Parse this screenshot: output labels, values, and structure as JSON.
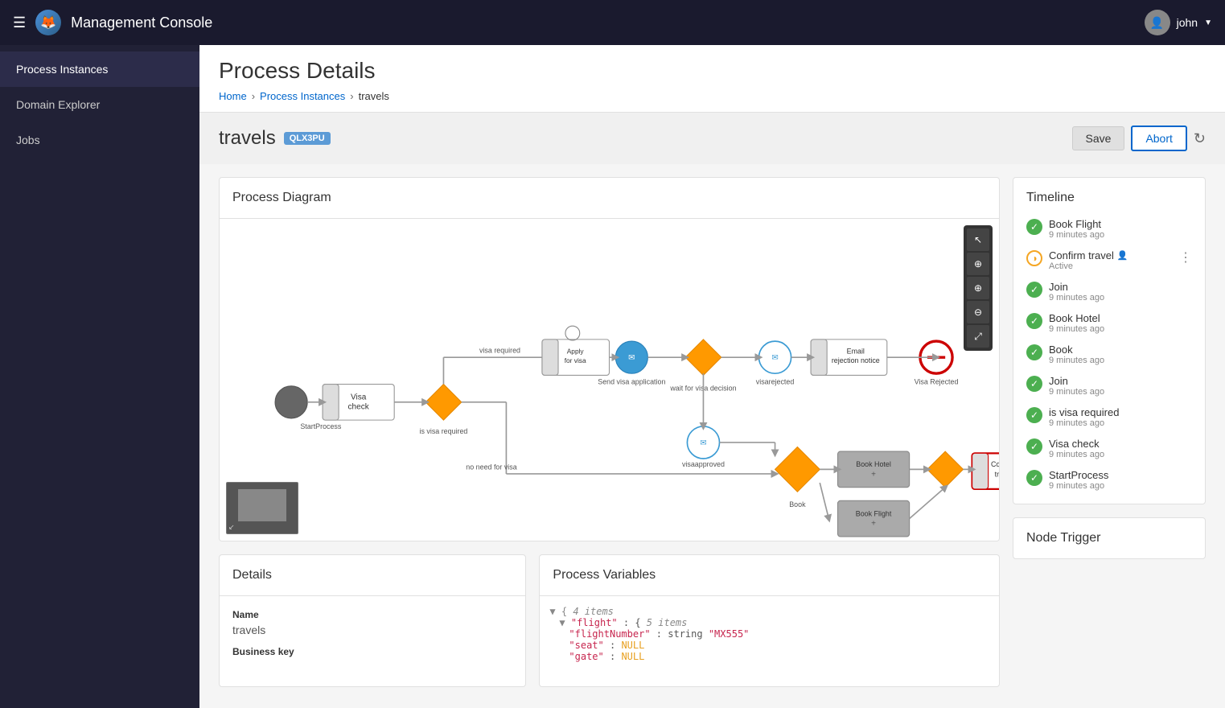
{
  "topbar": {
    "title": "Management Console",
    "user": "john"
  },
  "sidebar": {
    "items": [
      {
        "id": "process-instances",
        "label": "Process Instances",
        "active": true
      },
      {
        "id": "domain-explorer",
        "label": "Domain Explorer",
        "active": false
      },
      {
        "id": "jobs",
        "label": "Jobs",
        "active": false
      }
    ]
  },
  "page": {
    "title": "Process Details",
    "breadcrumb": {
      "home": "Home",
      "process_instances": "Process Instances",
      "current": "travels"
    }
  },
  "process": {
    "name": "travels",
    "badge": "QLX3PU",
    "save_label": "Save",
    "abort_label": "Abort"
  },
  "diagram": {
    "title": "Process Diagram"
  },
  "timeline": {
    "title": "Timeline",
    "items": [
      {
        "name": "Book Flight",
        "time": "9 minutes ago",
        "status": "",
        "type": "success",
        "has_person": false
      },
      {
        "name": "Confirm travel",
        "time": "",
        "status": "Active",
        "type": "active",
        "has_person": true
      },
      {
        "name": "Join",
        "time": "9 minutes ago",
        "status": "",
        "type": "success",
        "has_person": false
      },
      {
        "name": "Book Hotel",
        "time": "9 minutes ago",
        "status": "",
        "type": "success",
        "has_person": false
      },
      {
        "name": "Book",
        "time": "9 minutes ago",
        "status": "",
        "type": "success",
        "has_person": false
      },
      {
        "name": "Join",
        "time": "9 minutes ago",
        "status": "",
        "type": "success",
        "has_person": false
      },
      {
        "name": "is visa required",
        "time": "9 minutes ago",
        "status": "",
        "type": "success",
        "has_person": false
      },
      {
        "name": "Visa check",
        "time": "9 minutes ago",
        "status": "",
        "type": "success",
        "has_person": false
      },
      {
        "name": "StartProcess",
        "time": "9 minutes ago",
        "status": "",
        "type": "success",
        "has_person": false
      }
    ]
  },
  "node_trigger": {
    "title": "Node Trigger"
  },
  "details": {
    "title": "Details",
    "name_label": "Name",
    "name_value": "travels",
    "business_key_label": "Business key"
  },
  "variables": {
    "title": "Process Variables",
    "content_lines": [
      "▼ {  4 items",
      "  ▼ \"flight\" : {  5 items",
      "      \"flightNumber\" : string \"MX555\"",
      "      \"seat\" : NULL",
      "      \"gate\" : NULL"
    ]
  }
}
